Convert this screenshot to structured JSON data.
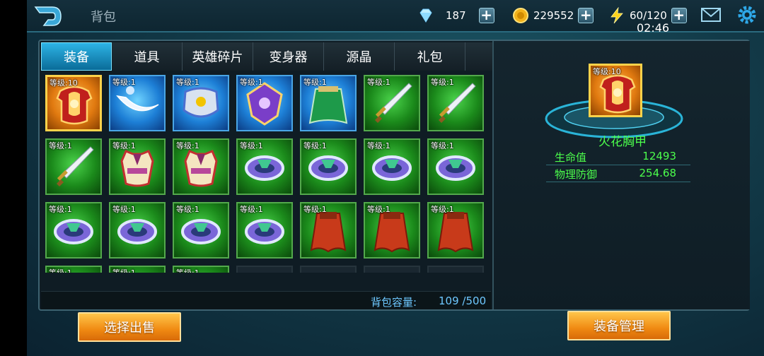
{
  "header": {
    "title": "背包",
    "diamonds": "187",
    "gold": "229552",
    "energy": "60/120",
    "clock": "02:46"
  },
  "tabs": [
    {
      "label": "装备",
      "active": true
    },
    {
      "label": "道具",
      "active": false
    },
    {
      "label": "英雄碎片",
      "active": false
    },
    {
      "label": "变身器",
      "active": false
    },
    {
      "label": "源晶",
      "active": false
    },
    {
      "label": "礼包",
      "active": false
    }
  ],
  "inventory": [
    {
      "level": "等级:10",
      "icon": "chest-armor-icon",
      "rarity": "gold"
    },
    {
      "level": "等级:1",
      "icon": "crescent-blade-icon",
      "rarity": "blue"
    },
    {
      "level": "等级:1",
      "icon": "silver-armor-icon",
      "rarity": "blue"
    },
    {
      "level": "等级:1",
      "icon": "purple-shield-icon",
      "rarity": "blue"
    },
    {
      "level": "等级:1",
      "icon": "green-cape-icon",
      "rarity": "blue"
    },
    {
      "level": "等级:1",
      "icon": "sword-icon",
      "rarity": "green"
    },
    {
      "level": "等级:1",
      "icon": "sword-icon",
      "rarity": "green"
    },
    {
      "level": "等级:1",
      "icon": "sword-icon",
      "rarity": "green"
    },
    {
      "level": "等级:1",
      "icon": "vest-armor-icon",
      "rarity": "green"
    },
    {
      "level": "等级:1",
      "icon": "vest-armor-icon",
      "rarity": "green"
    },
    {
      "level": "等级:1",
      "icon": "bracer-icon",
      "rarity": "green"
    },
    {
      "level": "等级:1",
      "icon": "bracer-icon",
      "rarity": "green"
    },
    {
      "level": "等级:1",
      "icon": "bracer-icon",
      "rarity": "green"
    },
    {
      "level": "等级:1",
      "icon": "bracer-icon",
      "rarity": "green"
    },
    {
      "level": "等级:1",
      "icon": "bracer-icon",
      "rarity": "green"
    },
    {
      "level": "等级:1",
      "icon": "bracer-icon",
      "rarity": "green"
    },
    {
      "level": "等级:1",
      "icon": "bracer-icon",
      "rarity": "green"
    },
    {
      "level": "等级:1",
      "icon": "bracer-icon",
      "rarity": "green"
    },
    {
      "level": "等级:1",
      "icon": "red-cloak-icon",
      "rarity": "green"
    },
    {
      "level": "等级:1",
      "icon": "red-cloak-icon",
      "rarity": "green"
    },
    {
      "level": "等级:1",
      "icon": "red-cloak-icon",
      "rarity": "green"
    },
    {
      "level": "等级:1",
      "icon": "item-icon",
      "rarity": "green"
    },
    {
      "level": "等级:1",
      "icon": "item-icon",
      "rarity": "green"
    },
    {
      "level": "等级:1",
      "icon": "item-icon",
      "rarity": "green"
    },
    {
      "level": "",
      "icon": "",
      "rarity": "empty"
    },
    {
      "level": "",
      "icon": "",
      "rarity": "empty"
    },
    {
      "level": "",
      "icon": "",
      "rarity": "empty"
    },
    {
      "level": "",
      "icon": "",
      "rarity": "empty"
    }
  ],
  "capacity": {
    "label": "背包容量:",
    "used": "109",
    "max": "/500"
  },
  "detail": {
    "level": "等级:10",
    "name": "火花胸甲",
    "stats": [
      {
        "key": "生命值",
        "value": "12493"
      },
      {
        "key": "物理防御",
        "value": "254.68"
      }
    ]
  },
  "buttons": {
    "sell": "选择出售",
    "manage": "装备管理"
  },
  "colors": {
    "accent_blue": "#2db4e6",
    "stat_green": "#4cff4c",
    "button_orange": "#f08a12"
  }
}
